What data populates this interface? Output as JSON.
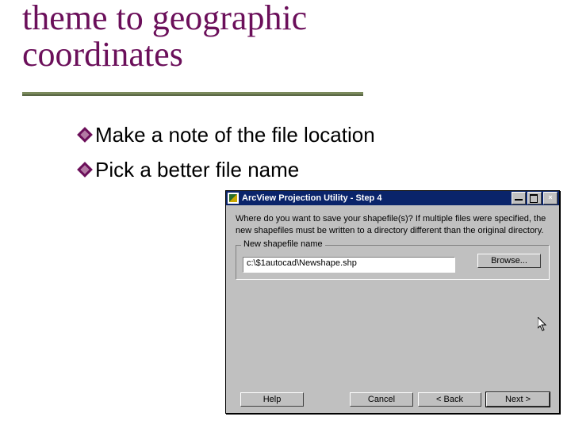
{
  "title": "theme to geographic coordinates",
  "bullets": [
    "Make a note of the file location",
    "Pick a better file name"
  ],
  "dialog": {
    "title": "ArcView Projection Utility - Step 4",
    "instruction": "Where do you want to save your shapefile(s)? If multiple files were specified, the new shapefiles must be written to a directory different than the original directory.",
    "fieldset_label": "New shapefile name",
    "path_value": "c:\\$1autocad\\Newshape.shp",
    "browse": "Browse...",
    "help": "Help",
    "cancel": "Cancel",
    "back": "< Back",
    "next": "Next >",
    "min_tip": "Minimize",
    "max_tip": "Maximize",
    "close_tip": "Close"
  }
}
